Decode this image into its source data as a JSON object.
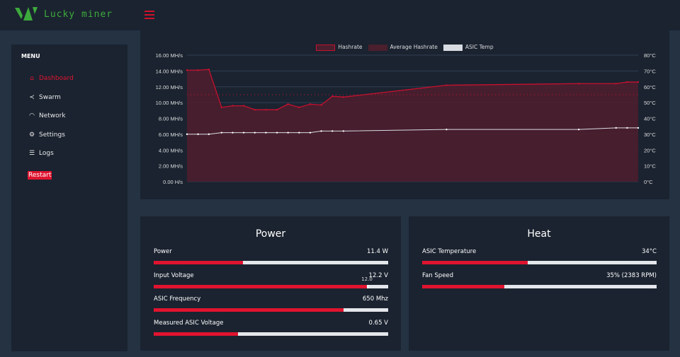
{
  "header": {
    "brand": "Lucky miner"
  },
  "sidebar": {
    "menu_title": "MENU",
    "items": [
      {
        "label": "Dashboard",
        "icon": "home-icon",
        "active": true
      },
      {
        "label": "Swarm",
        "icon": "share-icon"
      },
      {
        "label": "Network",
        "icon": "wifi-icon"
      },
      {
        "label": "Settings",
        "icon": "gear-icon"
      },
      {
        "label": "Logs",
        "icon": "list-icon"
      }
    ],
    "restart_label": "Restart"
  },
  "chart_data": {
    "type": "line",
    "legend": [
      "Hashrate",
      "Average Hashrate",
      "ASIC Temp"
    ],
    "x": [
      0,
      33,
      65,
      103,
      136,
      169,
      202,
      235,
      268,
      301,
      334,
      367,
      400,
      433,
      466,
      773,
      1167,
      1278,
      1311,
      1344
    ],
    "series": [
      {
        "name": "Hashrate",
        "axis": "left",
        "values": [
          14.1,
          14.1,
          14.2,
          9.4,
          9.6,
          9.6,
          9.1,
          9.1,
          9.1,
          9.8,
          9.4,
          9.8,
          9.7,
          10.8,
          10.7,
          12.2,
          12.4,
          12.4,
          12.6,
          12.6
        ]
      },
      {
        "name": "Average Hashrate",
        "axis": "left",
        "values": [
          11.0,
          11.0,
          11.0,
          11.0,
          11.0,
          11.0,
          11.0,
          11.0,
          11.0,
          11.0,
          11.0,
          11.0,
          11.0,
          11.0,
          11.0,
          11.0,
          11.0,
          11.0,
          11.0,
          11.0
        ]
      },
      {
        "name": "ASIC Temp",
        "axis": "right",
        "values": [
          30,
          30,
          30,
          31,
          31,
          31,
          31,
          31,
          31,
          31,
          31,
          31,
          32,
          32,
          32,
          33,
          33,
          34,
          34,
          34
        ]
      }
    ],
    "ylim": [
      0,
      16
    ],
    "y2lim": [
      0,
      80
    ],
    "yticks": [
      "0.00 H/s",
      "2.00 MH/s",
      "4.00 MH/s",
      "6.00 MH/s",
      "8.00 MH/s",
      "10.00 MH/s",
      "12.00 MH/s",
      "14.00 MH/s",
      "16.00 MH/s"
    ],
    "y2ticks": [
      "0°C",
      "10°C",
      "20°C",
      "30°C",
      "40°C",
      "50°C",
      "60°C",
      "70°C",
      "80°C"
    ],
    "colors": {
      "hashrate": "#c8102e",
      "fill": "#4a1f2e",
      "temp": "#d8dce2"
    }
  },
  "power": {
    "title": "Power",
    "rows": [
      {
        "label": "Power",
        "value": "11.4 W",
        "percent": 38
      },
      {
        "label": "Input Voltage",
        "value": "12.2 V",
        "percent": 91,
        "marker": "12.0"
      },
      {
        "label": "ASIC Frequency",
        "value": "650 Mhz",
        "percent": 81
      },
      {
        "label": "Measured ASIC Voltage",
        "value": "0.65 V",
        "percent": 36
      }
    ]
  },
  "heat": {
    "title": "Heat",
    "rows": [
      {
        "label": "ASIC Temperature",
        "value": "34°C",
        "percent": 45
      },
      {
        "label": "Fan Speed",
        "value": "35% (2383 RPM)",
        "percent": 35
      }
    ]
  }
}
